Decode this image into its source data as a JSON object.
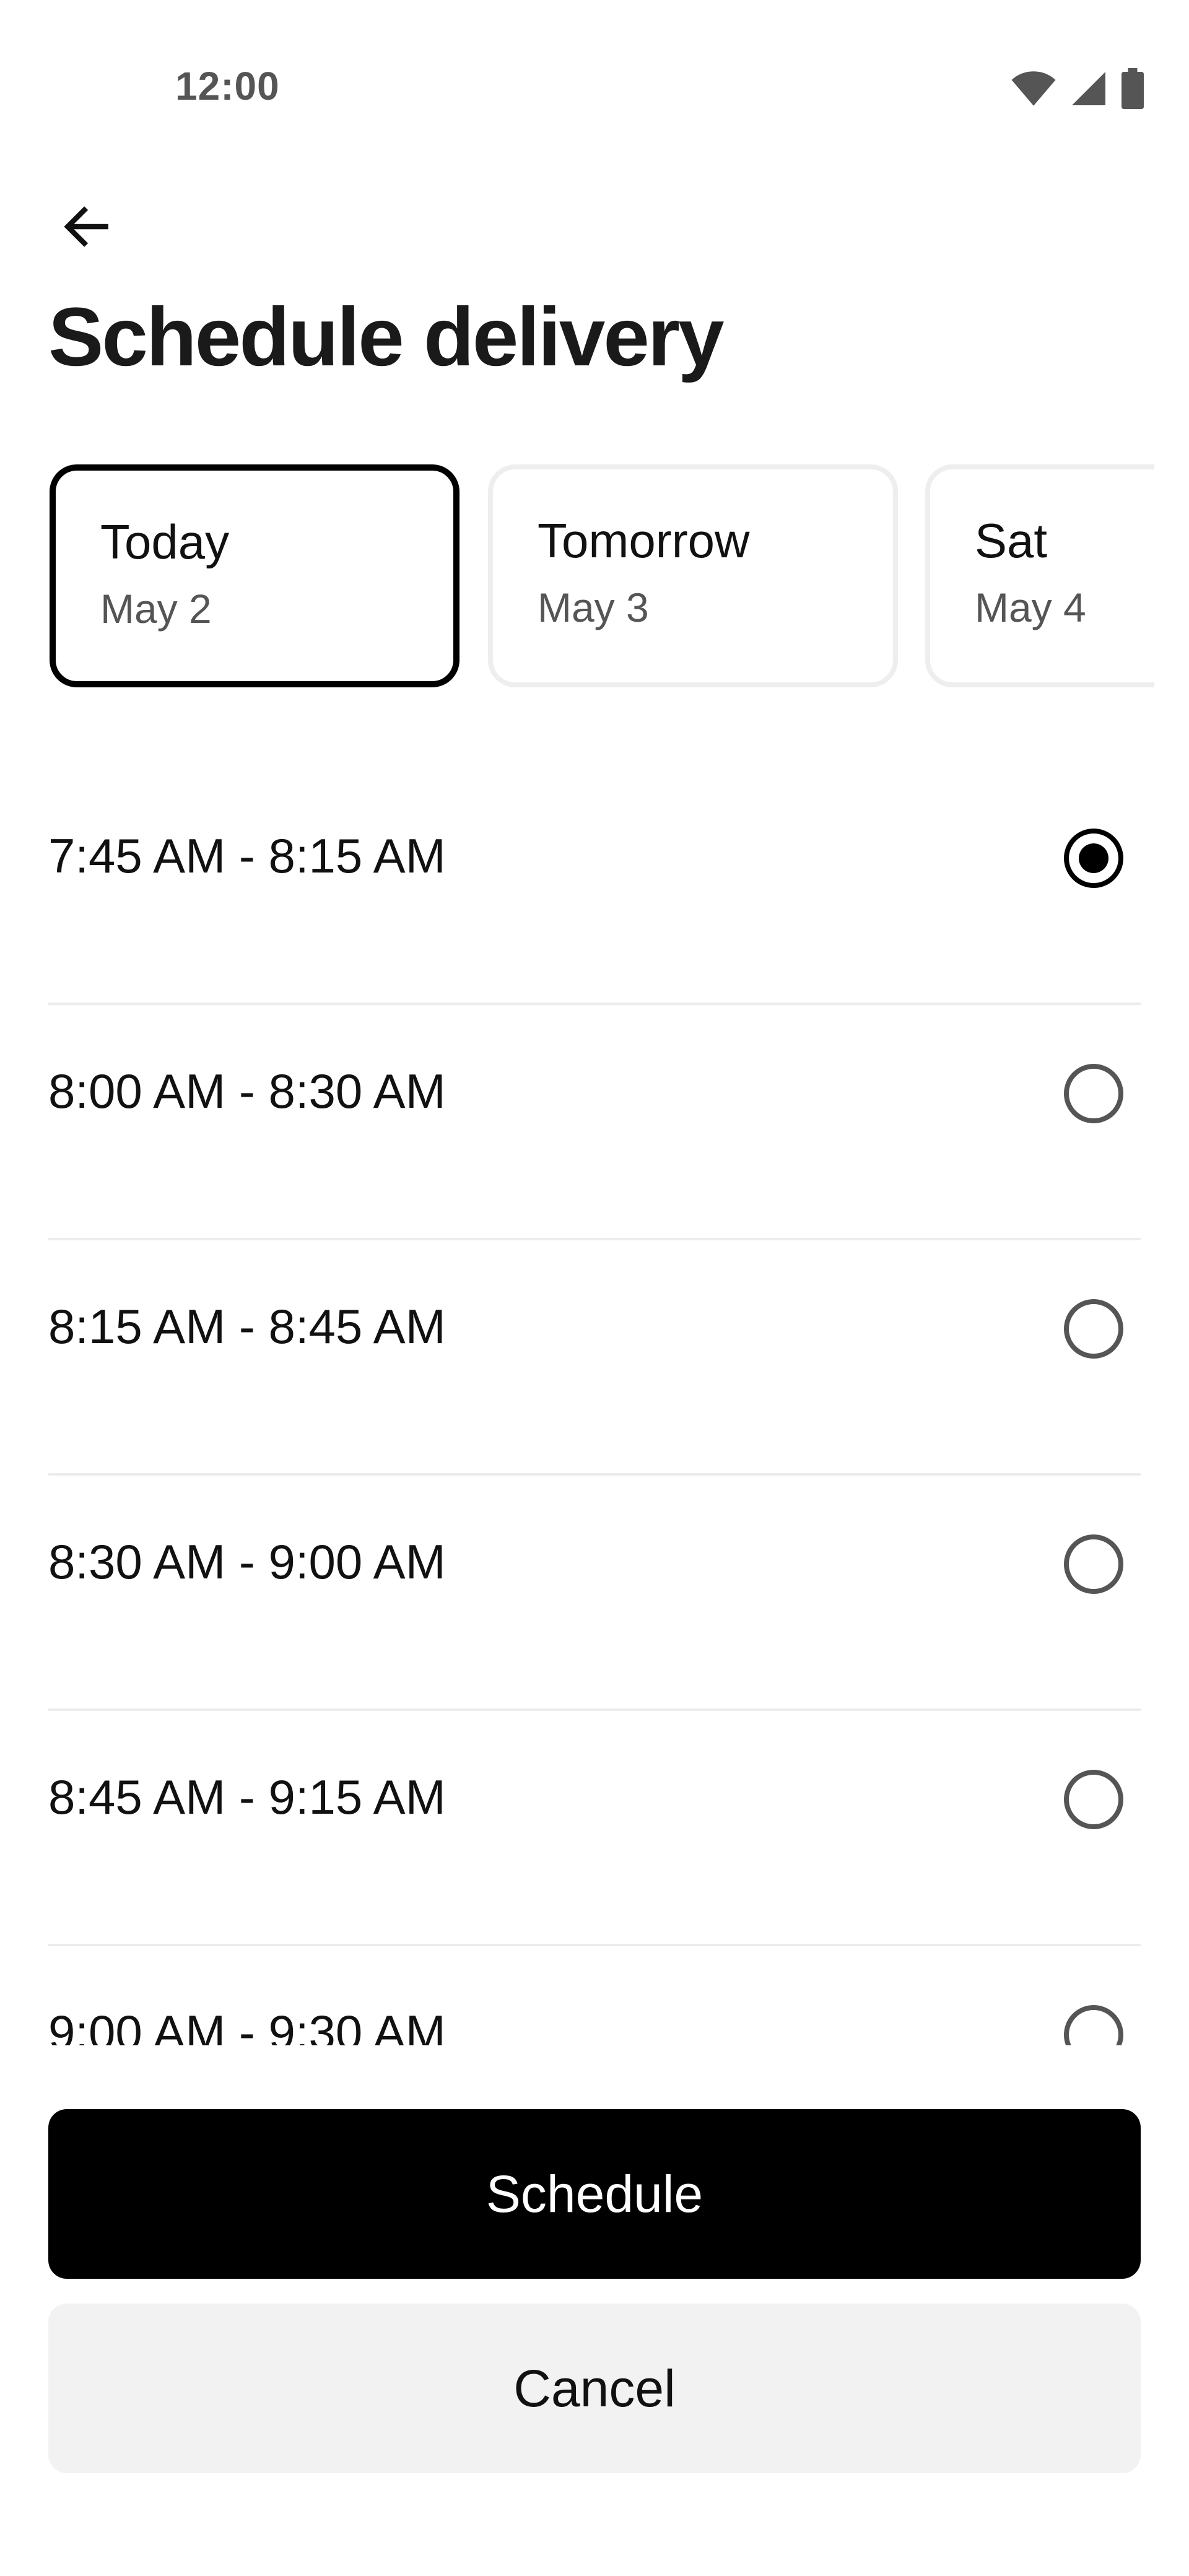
{
  "status_bar": {
    "time": "12:00",
    "icons": [
      "wifi-icon",
      "cellular-signal-icon",
      "battery-icon"
    ]
  },
  "header": {
    "back_icon": "arrow-left-icon",
    "title": "Schedule delivery"
  },
  "dates": [
    {
      "day": "Today",
      "date": "May 2",
      "selected": true
    },
    {
      "day": "Tomorrow",
      "date": "May 3",
      "selected": false
    },
    {
      "day": "Sat",
      "date": "May 4",
      "selected": false
    }
  ],
  "slots": [
    {
      "label": "7:45 AM - 8:15 AM",
      "selected": true
    },
    {
      "label": "8:00 AM - 8:30 AM",
      "selected": false
    },
    {
      "label": "8:15 AM - 8:45 AM",
      "selected": false
    },
    {
      "label": "8:30 AM - 9:00 AM",
      "selected": false
    },
    {
      "label": "8:45 AM - 9:15 AM",
      "selected": false
    },
    {
      "label": "9:00 AM - 9:30 AM",
      "selected": false
    }
  ],
  "actions": {
    "schedule_label": "Schedule",
    "cancel_label": "Cancel"
  },
  "colors": {
    "primary": "#000000",
    "secondary_button": "#f2f2f2",
    "divider": "#ececec",
    "muted_text": "#555555"
  }
}
